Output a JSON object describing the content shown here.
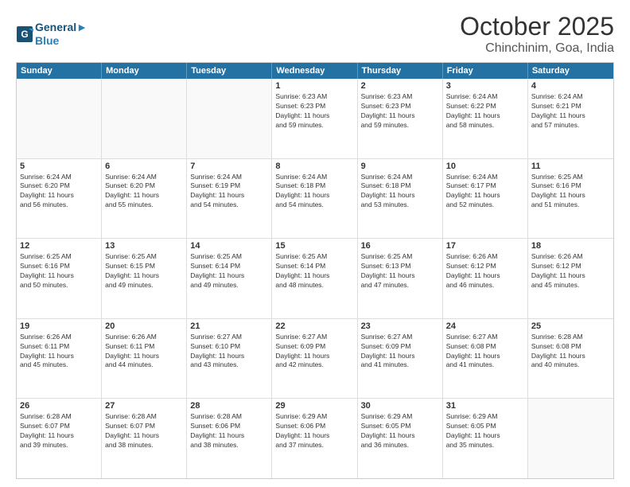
{
  "header": {
    "logo_line1": "General",
    "logo_line2": "Blue",
    "month": "October 2025",
    "location": "Chinchinim, Goa, India"
  },
  "weekdays": [
    "Sunday",
    "Monday",
    "Tuesday",
    "Wednesday",
    "Thursday",
    "Friday",
    "Saturday"
  ],
  "weeks": [
    [
      {
        "day": "",
        "text": ""
      },
      {
        "day": "",
        "text": ""
      },
      {
        "day": "",
        "text": ""
      },
      {
        "day": "1",
        "text": "Sunrise: 6:23 AM\nSunset: 6:23 PM\nDaylight: 11 hours\nand 59 minutes."
      },
      {
        "day": "2",
        "text": "Sunrise: 6:23 AM\nSunset: 6:23 PM\nDaylight: 11 hours\nand 59 minutes."
      },
      {
        "day": "3",
        "text": "Sunrise: 6:24 AM\nSunset: 6:22 PM\nDaylight: 11 hours\nand 58 minutes."
      },
      {
        "day": "4",
        "text": "Sunrise: 6:24 AM\nSunset: 6:21 PM\nDaylight: 11 hours\nand 57 minutes."
      }
    ],
    [
      {
        "day": "5",
        "text": "Sunrise: 6:24 AM\nSunset: 6:20 PM\nDaylight: 11 hours\nand 56 minutes."
      },
      {
        "day": "6",
        "text": "Sunrise: 6:24 AM\nSunset: 6:20 PM\nDaylight: 11 hours\nand 55 minutes."
      },
      {
        "day": "7",
        "text": "Sunrise: 6:24 AM\nSunset: 6:19 PM\nDaylight: 11 hours\nand 54 minutes."
      },
      {
        "day": "8",
        "text": "Sunrise: 6:24 AM\nSunset: 6:18 PM\nDaylight: 11 hours\nand 54 minutes."
      },
      {
        "day": "9",
        "text": "Sunrise: 6:24 AM\nSunset: 6:18 PM\nDaylight: 11 hours\nand 53 minutes."
      },
      {
        "day": "10",
        "text": "Sunrise: 6:24 AM\nSunset: 6:17 PM\nDaylight: 11 hours\nand 52 minutes."
      },
      {
        "day": "11",
        "text": "Sunrise: 6:25 AM\nSunset: 6:16 PM\nDaylight: 11 hours\nand 51 minutes."
      }
    ],
    [
      {
        "day": "12",
        "text": "Sunrise: 6:25 AM\nSunset: 6:16 PM\nDaylight: 11 hours\nand 50 minutes."
      },
      {
        "day": "13",
        "text": "Sunrise: 6:25 AM\nSunset: 6:15 PM\nDaylight: 11 hours\nand 49 minutes."
      },
      {
        "day": "14",
        "text": "Sunrise: 6:25 AM\nSunset: 6:14 PM\nDaylight: 11 hours\nand 49 minutes."
      },
      {
        "day": "15",
        "text": "Sunrise: 6:25 AM\nSunset: 6:14 PM\nDaylight: 11 hours\nand 48 minutes."
      },
      {
        "day": "16",
        "text": "Sunrise: 6:25 AM\nSunset: 6:13 PM\nDaylight: 11 hours\nand 47 minutes."
      },
      {
        "day": "17",
        "text": "Sunrise: 6:26 AM\nSunset: 6:12 PM\nDaylight: 11 hours\nand 46 minutes."
      },
      {
        "day": "18",
        "text": "Sunrise: 6:26 AM\nSunset: 6:12 PM\nDaylight: 11 hours\nand 45 minutes."
      }
    ],
    [
      {
        "day": "19",
        "text": "Sunrise: 6:26 AM\nSunset: 6:11 PM\nDaylight: 11 hours\nand 45 minutes."
      },
      {
        "day": "20",
        "text": "Sunrise: 6:26 AM\nSunset: 6:11 PM\nDaylight: 11 hours\nand 44 minutes."
      },
      {
        "day": "21",
        "text": "Sunrise: 6:27 AM\nSunset: 6:10 PM\nDaylight: 11 hours\nand 43 minutes."
      },
      {
        "day": "22",
        "text": "Sunrise: 6:27 AM\nSunset: 6:09 PM\nDaylight: 11 hours\nand 42 minutes."
      },
      {
        "day": "23",
        "text": "Sunrise: 6:27 AM\nSunset: 6:09 PM\nDaylight: 11 hours\nand 41 minutes."
      },
      {
        "day": "24",
        "text": "Sunrise: 6:27 AM\nSunset: 6:08 PM\nDaylight: 11 hours\nand 41 minutes."
      },
      {
        "day": "25",
        "text": "Sunrise: 6:28 AM\nSunset: 6:08 PM\nDaylight: 11 hours\nand 40 minutes."
      }
    ],
    [
      {
        "day": "26",
        "text": "Sunrise: 6:28 AM\nSunset: 6:07 PM\nDaylight: 11 hours\nand 39 minutes."
      },
      {
        "day": "27",
        "text": "Sunrise: 6:28 AM\nSunset: 6:07 PM\nDaylight: 11 hours\nand 38 minutes."
      },
      {
        "day": "28",
        "text": "Sunrise: 6:28 AM\nSunset: 6:06 PM\nDaylight: 11 hours\nand 38 minutes."
      },
      {
        "day": "29",
        "text": "Sunrise: 6:29 AM\nSunset: 6:06 PM\nDaylight: 11 hours\nand 37 minutes."
      },
      {
        "day": "30",
        "text": "Sunrise: 6:29 AM\nSunset: 6:05 PM\nDaylight: 11 hours\nand 36 minutes."
      },
      {
        "day": "31",
        "text": "Sunrise: 6:29 AM\nSunset: 6:05 PM\nDaylight: 11 hours\nand 35 minutes."
      },
      {
        "day": "",
        "text": ""
      }
    ]
  ]
}
